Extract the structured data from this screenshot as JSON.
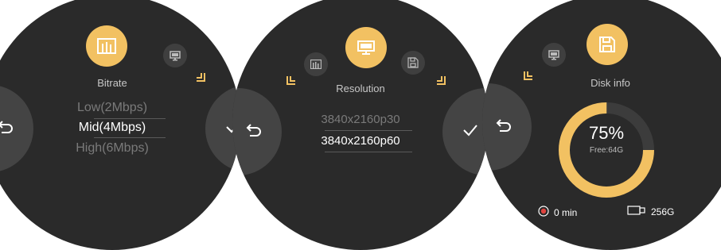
{
  "screens": [
    {
      "title": "Bitrate",
      "options": [
        "Low(2Mbps)",
        "Mid(4Mbps)",
        "High(6Mbps)"
      ],
      "main_icon": "bitrate-icon",
      "secondary_icon": "monitor-icon"
    },
    {
      "title": "Resolution",
      "options": [
        "3840x2160p30",
        "3840x2160p60"
      ],
      "main_icon": "monitor-icon",
      "left_icon": "bitrate-icon",
      "right_icon": "save-icon"
    },
    {
      "title": "Disk info",
      "percent": "75%",
      "free": "Free:64G",
      "usage_fraction": 0.75,
      "record_time": "0 min",
      "capacity": "256G",
      "main_icon": "save-icon",
      "secondary_icon": "monitor-icon"
    }
  ],
  "colors": {
    "accent": "#f2c162",
    "screen_bg": "#2a2a2a",
    "button_bg": "#444444",
    "record_red": "#e0443f"
  }
}
